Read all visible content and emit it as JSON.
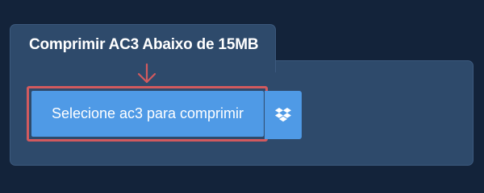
{
  "header": {
    "title": "Comprimir AC3 Abaixo de 15MB"
  },
  "upload": {
    "select_label": "Selecione ac3 para comprimir",
    "dropbox_icon": "dropbox-icon",
    "pointer_icon": "arrow-down-icon"
  },
  "colors": {
    "background": "#13233a",
    "panel": "#2e4a6b",
    "button": "#4f9ae6",
    "highlight": "#d25a5e"
  }
}
